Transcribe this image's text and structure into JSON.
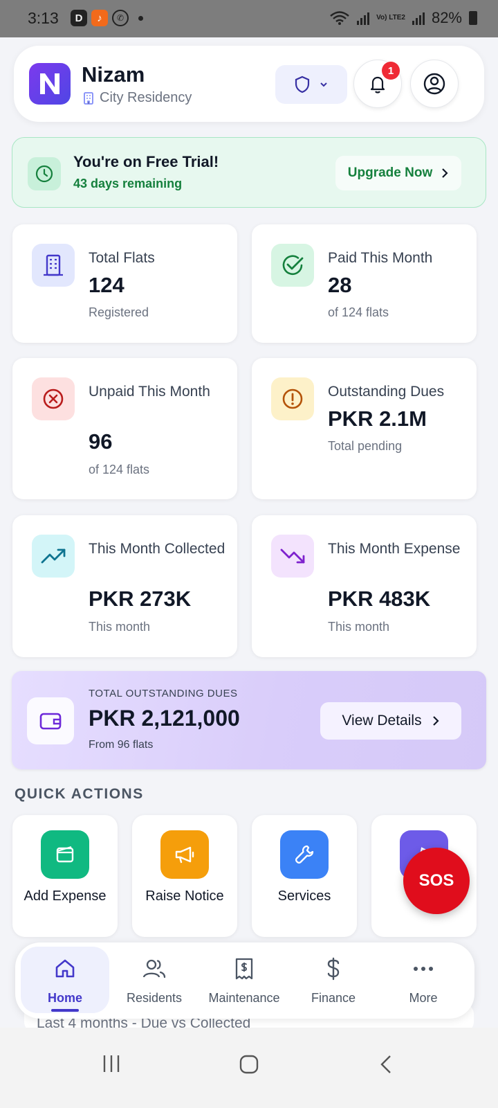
{
  "status_bar": {
    "time": "3:13",
    "battery": "82%",
    "network": "Vo) LTE2"
  },
  "header": {
    "app_name": "Nizam",
    "society": "City Residency",
    "notification_count": "1"
  },
  "trial": {
    "title": "You're on Free Trial!",
    "remaining": "43 days remaining",
    "upgrade_label": "Upgrade Now"
  },
  "stats": {
    "total_flats": {
      "label": "Total Flats",
      "value": "124",
      "note": "Registered"
    },
    "paid": {
      "label": "Paid This Month",
      "value": "28",
      "note": "of 124 flats"
    },
    "unpaid": {
      "label": "Unpaid This Month",
      "value": "96",
      "note": "of 124 flats"
    },
    "outstanding": {
      "label": "Outstanding Dues",
      "value": "PKR 2.1M",
      "note": "Total pending"
    },
    "collected": {
      "label": "This Month Collected",
      "value": "PKR 273K",
      "note": "This month"
    },
    "expense": {
      "label": "This Month Expense",
      "value": "PKR 483K",
      "note": "This month"
    }
  },
  "dues_banner": {
    "caption": "TOTAL OUTSTANDING DUES",
    "amount": "PKR 2,121,000",
    "from": "From 96 flats",
    "button": "View Details"
  },
  "quick_actions": {
    "title": "QUICK ACTIONS",
    "items": [
      {
        "label": "Add Expense",
        "color": "#10b981",
        "icon": "wallet-icon"
      },
      {
        "label": "Raise Notice",
        "color": "#f59e0b",
        "icon": "megaphone-icon"
      },
      {
        "label": "Services",
        "color": "#3b82f6",
        "icon": "wrench-icon"
      },
      {
        "label": "",
        "color": "#6d5be8",
        "icon": "partial-icon"
      }
    ]
  },
  "sos_label": "SOS",
  "chart_caption": "Last 4 months - Due vs Collected",
  "bottom_nav": {
    "items": [
      {
        "label": "Home",
        "icon": "home-icon",
        "active": true
      },
      {
        "label": "Residents",
        "icon": "users-icon"
      },
      {
        "label": "Maintenance",
        "icon": "receipt-icon"
      },
      {
        "label": "Finance",
        "icon": "dollar-icon"
      },
      {
        "label": "More",
        "icon": "more-icon"
      }
    ]
  },
  "colors": {
    "brand": "#4f46e5",
    "success": "#15803d",
    "danger": "#e00d1c",
    "warning": "#b45309"
  }
}
